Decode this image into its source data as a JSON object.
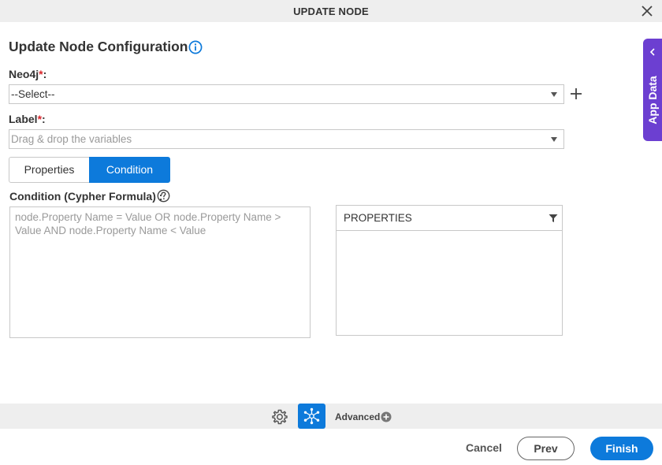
{
  "window": {
    "title": "UPDATE NODE",
    "close_icon": "close-icon"
  },
  "page": {
    "heading": "Update Node Configuration",
    "info_icon": "info-icon"
  },
  "form": {
    "neo4j": {
      "label": "Neo4j",
      "required_mark": "*",
      "colon": ":",
      "value": "--Select--",
      "add_icon": "plus-icon"
    },
    "label_field": {
      "label": "Label",
      "required_mark": "*",
      "colon": ":",
      "placeholder": "Drag & drop the variables"
    }
  },
  "tabs": [
    {
      "label": "Properties",
      "active": false
    },
    {
      "label": "Condition",
      "active": true
    }
  ],
  "condition": {
    "label": "Condition (Cypher Formula) :",
    "placeholder": "node.Property Name = Value OR node.Property Name > Value AND node.Property Name < Value",
    "help_icon": "question-circle-icon"
  },
  "properties_panel": {
    "title": "PROPERTIES",
    "filter_icon": "filter-icon"
  },
  "app_data": {
    "label": "App Data",
    "chevron_icon": "chevron-left-icon"
  },
  "toolbar": {
    "settings_icon": "gear-icon",
    "node_icon": "node-network-icon",
    "advanced_label": "Advanced",
    "advanced_icon": "plus-circle-icon"
  },
  "footer": {
    "cancel_label": "Cancel",
    "prev_label": "Prev",
    "finish_label": "Finish"
  },
  "colors": {
    "primary": "#0d7adb",
    "app_data": "#6c3fd1",
    "required": "#d9262c",
    "bar_bg": "#eeeeee"
  }
}
